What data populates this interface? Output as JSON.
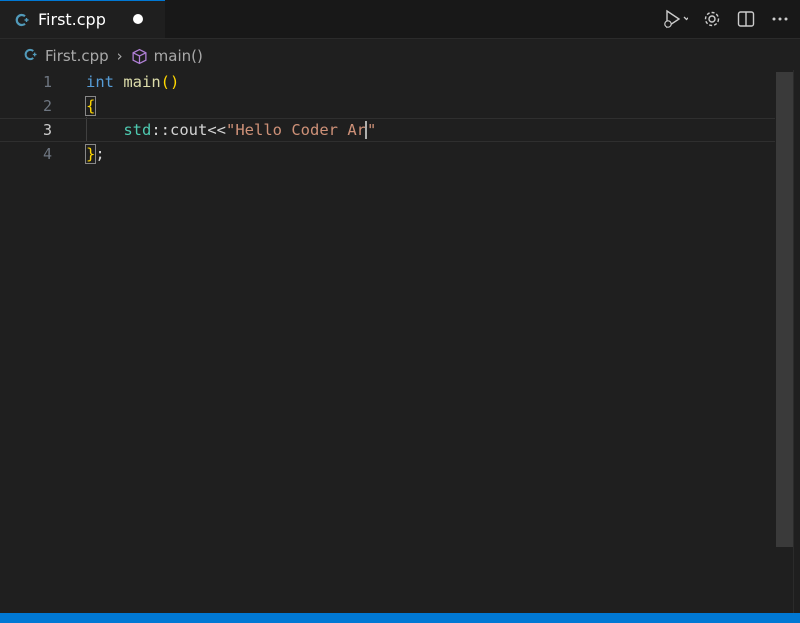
{
  "tab": {
    "filename": "First.cpp",
    "file_icon": "cpp-file-icon",
    "dirty": true
  },
  "toolbar": {
    "actions": [
      "run-debug-icon",
      "chevron-down-icon",
      "gear-icon",
      "split-editor-icon",
      "more-icon"
    ]
  },
  "breadcrumb": {
    "file": "First.cpp",
    "symbol": "main()",
    "symbol_icon": "cube-icon"
  },
  "editor": {
    "lines": [
      {
        "number": "1",
        "tokens": [
          {
            "t": "int",
            "c": "kw"
          },
          {
            "t": " ",
            "c": "plain"
          },
          {
            "t": "main",
            "c": "fn"
          },
          {
            "t": "()",
            "c": "paren"
          }
        ]
      },
      {
        "number": "2",
        "tokens": [
          {
            "t": "{",
            "c": "brace"
          }
        ]
      },
      {
        "number": "3",
        "tokens": [
          {
            "t": "    ",
            "c": "plain"
          },
          {
            "t": "std",
            "c": "ns"
          },
          {
            "t": "::",
            "c": "plain"
          },
          {
            "t": "cout",
            "c": "plain"
          },
          {
            "t": "<<",
            "c": "plain"
          },
          {
            "t": "\"Hello Coder Ar",
            "c": "str"
          },
          {
            "t": "\"",
            "c": "str"
          }
        ]
      },
      {
        "number": "4",
        "tokens": [
          {
            "t": "}",
            "c": "brace"
          },
          {
            "t": ";",
            "c": "plain"
          }
        ]
      }
    ],
    "active_line": 3
  },
  "colors": {
    "accent": "#0078d4",
    "background": "#1f1f1f",
    "keyword": "#569cd6",
    "function": "#dcdcaa",
    "string": "#ce9178",
    "namespace": "#4ec9b0"
  }
}
